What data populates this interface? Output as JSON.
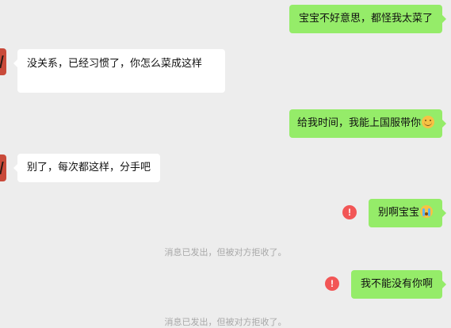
{
  "messages": [
    {
      "side": "right",
      "text": "宝宝不好意思，都怪我太菜了"
    },
    {
      "side": "left",
      "text": "没关系，已经习惯了，你怎么菜成这样"
    },
    {
      "side": "right",
      "text": "给我时间，我能上国服带你",
      "emoji": "upside-down-face"
    },
    {
      "side": "left",
      "text": "别了，每次都这样，分手吧"
    },
    {
      "side": "right",
      "text": "别啊宝宝",
      "emoji": "loudly-crying-face",
      "failed": true
    },
    {
      "side": "right",
      "text": "我不能没有你啊",
      "failed": true
    }
  ],
  "error_icon": "!",
  "notices": [
    "消息已发出，但被对方拒收了。",
    "消息已发出，但被对方拒收了。"
  ],
  "colors": {
    "background": "#ededed",
    "sent_bubble": "#95ec69",
    "received_bubble": "#ffffff",
    "error": "#f25656",
    "notice_text": "#a8a8a8"
  }
}
